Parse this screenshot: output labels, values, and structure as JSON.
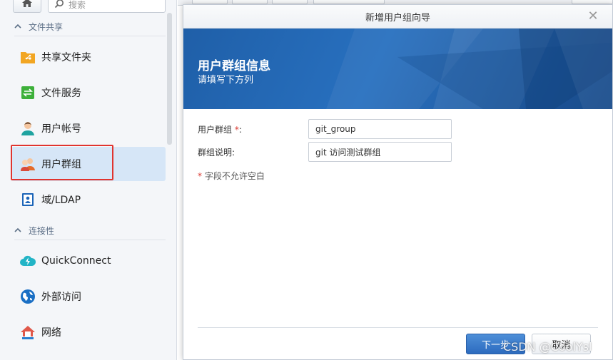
{
  "sidebar": {
    "search_placeholder": "搜索",
    "section_file_sharing": "文件共享",
    "section_connectivity": "连接性",
    "items": [
      {
        "label": "共享文件夹",
        "icon": "shared-folder-icon"
      },
      {
        "label": "文件服务",
        "icon": "file-services-icon"
      },
      {
        "label": "用户帐号",
        "icon": "user-icon"
      },
      {
        "label": "用户群组",
        "icon": "user-group-icon",
        "active": true
      },
      {
        "label": "域/LDAP",
        "icon": "domain-ldap-icon"
      },
      {
        "label": "QuickConnect",
        "icon": "quickconnect-icon"
      },
      {
        "label": "外部访问",
        "icon": "external-access-icon"
      },
      {
        "label": "网络",
        "icon": "network-icon"
      }
    ]
  },
  "dialog": {
    "title": "新增用户组向导",
    "banner_title": "用户群组信息",
    "banner_subtitle": "请填写下方列",
    "fields": {
      "group_label": "用户群组",
      "group_required": "*",
      "group_colon": ":",
      "group_value": "git_group",
      "desc_label": "群组说明:",
      "desc_value": "git 访问测试群组"
    },
    "required_note_star": "*",
    "required_note": "字段不允许空白",
    "next_button": "下一步",
    "cancel_button": "取消"
  },
  "watermark": "CSDN @CoolYsl",
  "colors": {
    "accent": "#2c6bbf",
    "highlight_border": "#e0342f",
    "active_item_bg": "#d6e6f7",
    "banner": "#1f5fa8"
  }
}
